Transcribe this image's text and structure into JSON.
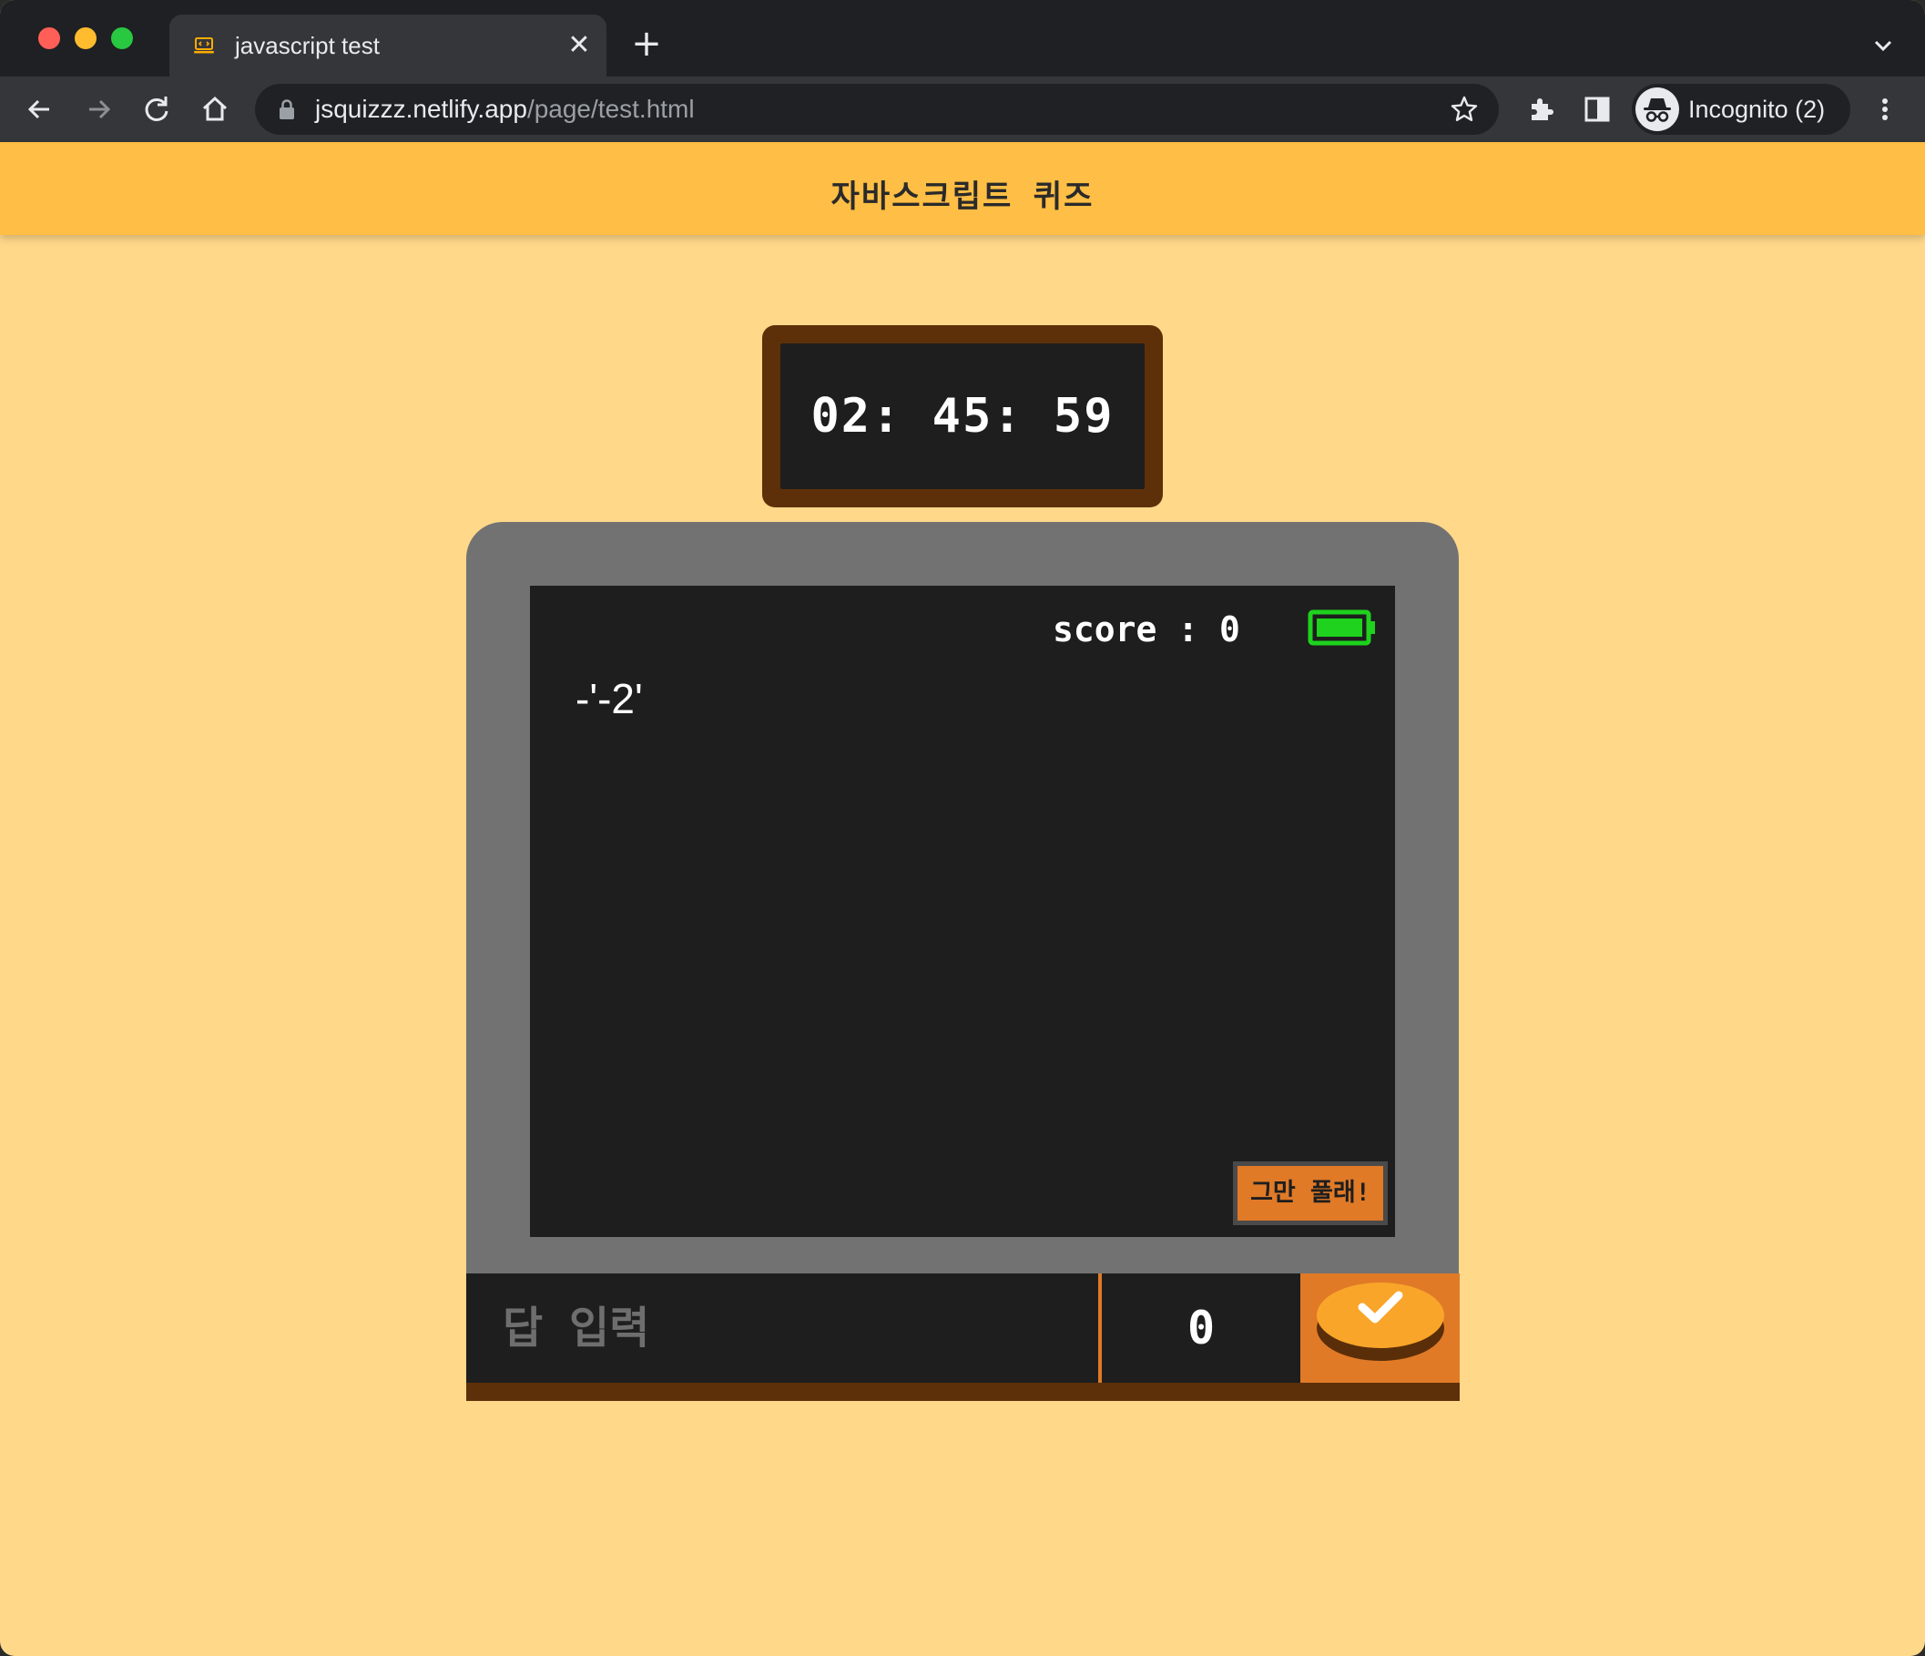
{
  "browser": {
    "tab": {
      "title": "javascript test",
      "favicon": "code-laptop-icon"
    },
    "address": {
      "host": "jsquizzz.netlify.app",
      "path": "/page/test.html"
    },
    "profile": {
      "label": "Incognito (2)",
      "icon": "incognito-icon"
    },
    "toolbar_icons": [
      "back-arrow-icon",
      "forward-arrow-icon",
      "reload-icon",
      "home-icon",
      "star-icon",
      "extensions-icon",
      "side-panel-icon",
      "kebab-menu-icon"
    ]
  },
  "page": {
    "title": "자바스크립트 퀴즈",
    "timer": {
      "text": "02: 45: 59"
    },
    "score": {
      "text": "score : 0",
      "battery_level": 1.0
    },
    "question": {
      "text": "-'-2'"
    },
    "give_up_button": {
      "label": "그만 풀래!"
    },
    "answer": {
      "placeholder": "답 입력",
      "value": ""
    },
    "counter": {
      "value": "0"
    },
    "submit": {
      "icon": "checkmark-icon"
    }
  },
  "colors": {
    "page_bg": "#ffd88a",
    "header_bg": "#ffbe45",
    "frame_brown": "#5e3009",
    "screen_bg": "#1e1e1e",
    "device_gray": "#727272",
    "accent_orange": "#e07a27",
    "button_yellow": "#f9a52a",
    "battery_green": "#1ed21e"
  }
}
